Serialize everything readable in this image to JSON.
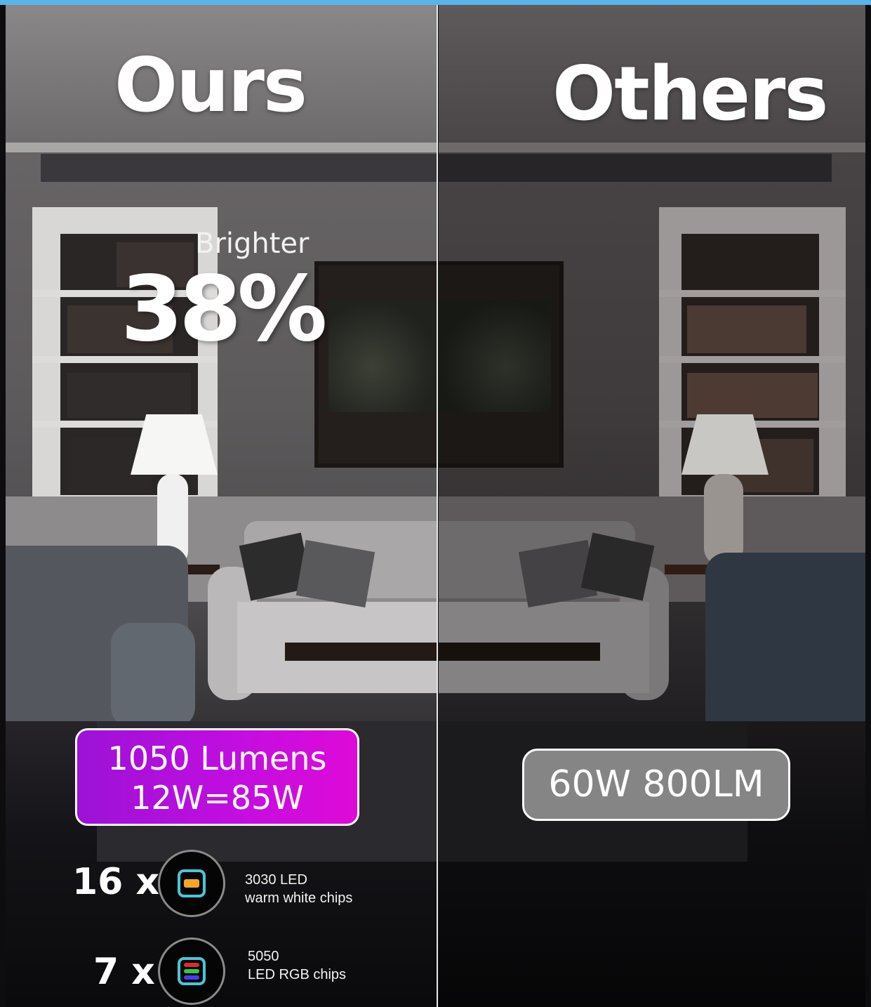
{
  "left_title": "Ours",
  "right_title": "Others",
  "brighter_label": "Brighter",
  "brighter_percent": "38%",
  "ours_box": {
    "line1": "1050 Lumens",
    "line2": "12W=85W",
    "color_start": "#9c12d6",
    "color_end": "#de0ad8"
  },
  "others_box": {
    "label": "60W 800LM",
    "color": "#858585"
  },
  "chips": [
    {
      "count": "16 x",
      "line1": "3030 LED",
      "line2": "warm white chips",
      "icon": "warm-white-chip-icon",
      "color": "#f5a623"
    },
    {
      "count": "7 x",
      "line1": "5050",
      "line2": "LED RGB chips",
      "icon": "rgb-chip-icon",
      "colors": [
        "#e8262a",
        "#2ecc40",
        "#4a3cff"
      ]
    }
  ],
  "colors": {
    "top_bar": "#5ab4e8",
    "divider": "#e8e8e8"
  }
}
